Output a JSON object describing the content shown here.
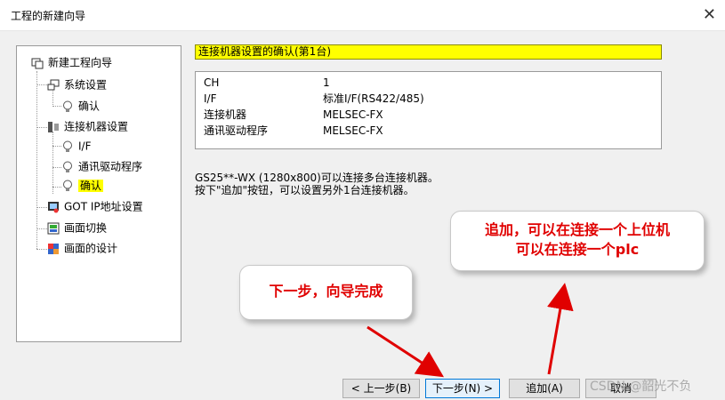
{
  "window": {
    "title": "工程的新建向导",
    "close_glyph": "✕"
  },
  "tree": {
    "items": [
      {
        "label": "新建工程向导",
        "icon": "wizard-icon"
      },
      {
        "label": "系统设置",
        "icon": "system-icon"
      },
      {
        "label": "确认",
        "icon": "bulb-icon"
      },
      {
        "label": "连接机器设置",
        "icon": "connection-icon"
      },
      {
        "label": "I/F",
        "icon": "bulb-icon"
      },
      {
        "label": "通讯驱动程序",
        "icon": "bulb-icon"
      },
      {
        "label": "确认",
        "icon": "bulb-icon",
        "selected": true
      },
      {
        "label": "GOT IP地址设置",
        "icon": "got-icon"
      },
      {
        "label": "画面切换",
        "icon": "screen-switch-icon"
      },
      {
        "label": "画面的设计",
        "icon": "screen-design-icon"
      }
    ]
  },
  "heading": "连接机器设置的确认(第1台)",
  "info": {
    "rows": [
      {
        "key": "CH",
        "value": "1"
      },
      {
        "key": "I/F",
        "value": "标准I/F(RS422/485)"
      },
      {
        "key": "连接机器",
        "value": "MELSEC-FX"
      },
      {
        "key": "通讯驱动程序",
        "value": "MELSEC-FX"
      }
    ]
  },
  "description": {
    "line1": "GS25**-WX (1280x800)可以连接多台连接机器。",
    "line2": "按下\"追加\"按钮，可以设置另外1台连接机器。"
  },
  "buttons": {
    "back": "< 上一步(B)",
    "next": "下一步(N) >",
    "add": "追加(A)",
    "cancel": "取消"
  },
  "annotations": {
    "next_note": "下一步，向导完成",
    "add_note_line1": "追加，可以在连接一个上位机",
    "add_note_line2": "可以在连接一个plc",
    "color": "#e00000"
  },
  "watermark": "CSDN @韶光不负",
  "colors": {
    "highlight": "#ffff00",
    "panel": "#f0f0f0",
    "arrow": "#e00000"
  }
}
